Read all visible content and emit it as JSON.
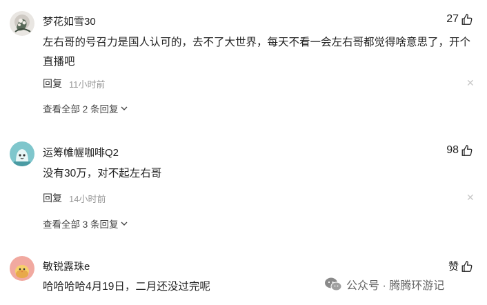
{
  "comments": [
    {
      "username": "梦花如雪30",
      "likes": "27",
      "text": "左右哥的号召力是国人认可的，去不了大世界，每天不看一会左右哥都觉得啥意思了，开个直播吧",
      "reply_label": "回复",
      "time": "11小时前",
      "view_all": "查看全部 2 条回复",
      "avatar_icon": "flower-photo-icon"
    },
    {
      "username": "运筹帷幄咖啡Q2",
      "likes": "98",
      "text": "没有30万，对不起左右哥",
      "reply_label": "回复",
      "time": "14小时前",
      "view_all": "查看全部 3 条回复",
      "avatar_icon": "cartoon-ghost-icon",
      "avatar_color": "#7fc6cc"
    },
    {
      "username": "敏锐露珠e",
      "likes": "赞",
      "text": "哈哈哈哈4月19日，二月还没过完呢",
      "avatar_icon": "cartoon-chick-icon",
      "avatar_color": "#f1a9a0"
    }
  ],
  "watermark": {
    "text": "公众号 · 腾腾环游记",
    "icon": "wechat-icon"
  }
}
